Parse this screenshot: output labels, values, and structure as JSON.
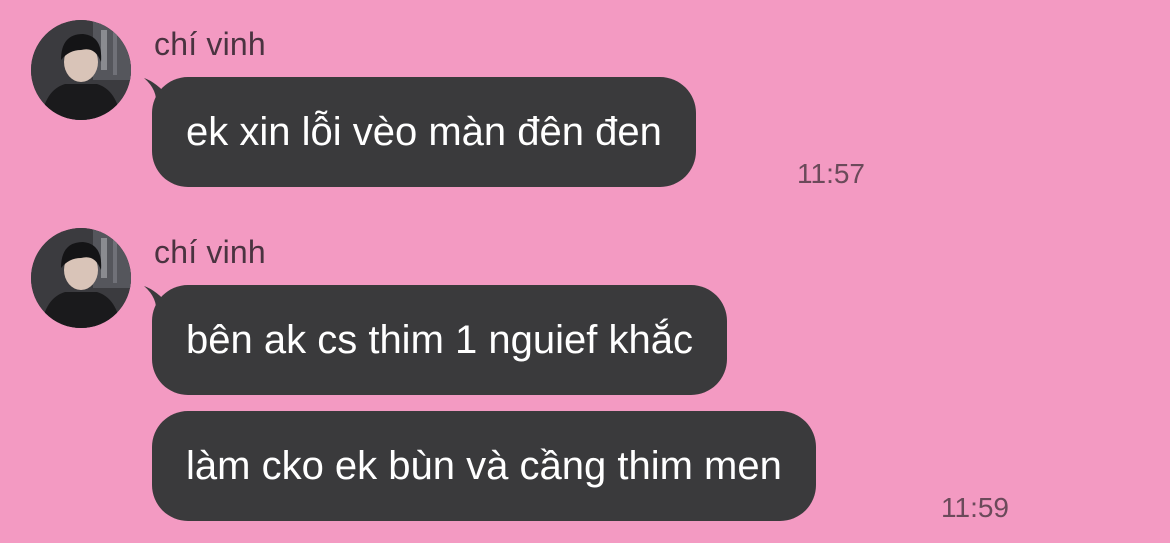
{
  "colors": {
    "background": "#f39ac2",
    "bubble": "#3a3a3c",
    "bubble_text": "#ffffff",
    "sender_text": "#4a3340",
    "time_text": "#6b4a5a"
  },
  "messages": [
    {
      "sender": "chí vinh",
      "avatar_icon": "profile-photo",
      "bubbles": [
        "ek xin lỗi vèo màn đên đen"
      ],
      "time": "11:57"
    },
    {
      "sender": "chí vinh",
      "avatar_icon": "profile-photo",
      "bubbles": [
        "bên ak cs thim 1 nguief khắc",
        "làm cko ek bùn và cầng thim men"
      ],
      "time": "11:59"
    }
  ]
}
